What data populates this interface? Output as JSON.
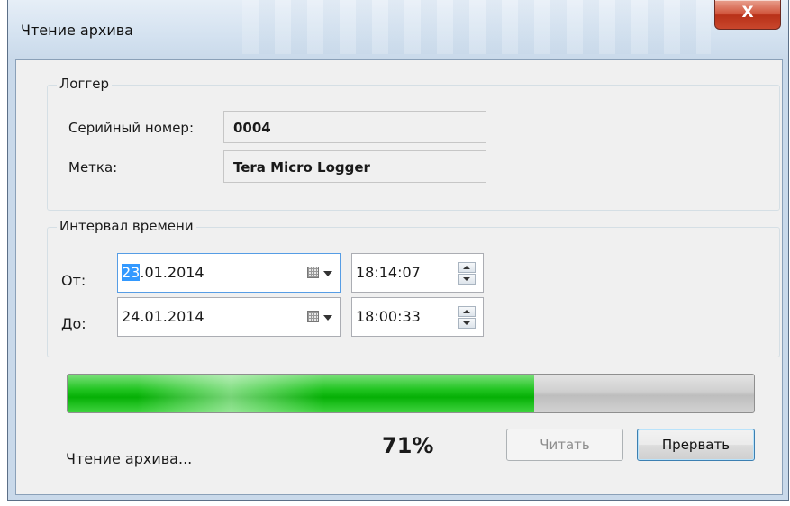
{
  "window": {
    "title": "Чтение архива",
    "close_label": "X"
  },
  "logger_group": {
    "caption": "Логгер",
    "serial_label": "Серийный номер:",
    "serial_value": "0004",
    "tag_label": "Метка:",
    "tag_value": "Tera Micro Logger"
  },
  "interval_group": {
    "caption": "Интервал времени",
    "from_label": "От:",
    "from_date_selected": "23",
    "from_date_rest": ".01.2014",
    "from_time": "18:14:07",
    "to_label": "До:",
    "to_date": "24.01.2014",
    "to_time": "18:00:33"
  },
  "progress": {
    "value_fraction": 0.68,
    "percent_text": "71%",
    "status_text": "Чтение архива..."
  },
  "buttons": {
    "read_label": "Читать",
    "abort_label": "Прервать"
  },
  "icons": {
    "calendar": "calendar-dropdown-icon",
    "spinner": "spin-up-down-icon"
  },
  "colors": {
    "progress_fill": "#06b006",
    "selection": "#3399ff",
    "close_button": "#c9462c"
  }
}
